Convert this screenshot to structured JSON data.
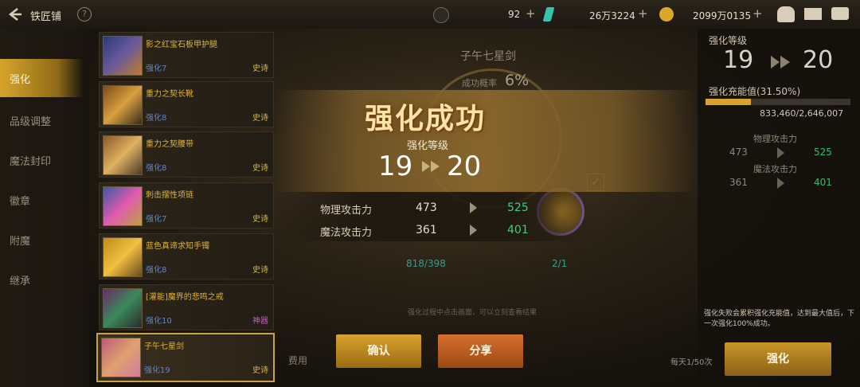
{
  "header": {
    "title": "铁匠铺",
    "res1": "92",
    "res2": "26万3224",
    "res3": "2099万0135"
  },
  "nav": {
    "items": [
      "强化",
      "品级调整",
      "魔法封印",
      "徽章",
      "附魔",
      "继承"
    ]
  },
  "equipment": [
    {
      "name": "影之红宝石板甲护腿",
      "level": "强化7",
      "rarity": "史诗"
    },
    {
      "name": "重力之契长靴",
      "level": "强化8",
      "rarity": "史诗"
    },
    {
      "name": "重力之契腰带",
      "level": "强化8",
      "rarity": "史诗"
    },
    {
      "name": "刺击摆性项链",
      "level": "强化7",
      "rarity": "史诗"
    },
    {
      "name": "蓝色真谛求知手镯",
      "level": "强化8",
      "rarity": "史诗"
    },
    {
      "name": "[灌能]魔界的悲鸣之戒",
      "level": "强化10",
      "rarity": "神器"
    },
    {
      "name": "子午七星剑",
      "level": "强化19",
      "rarity": "史诗"
    }
  ],
  "center": {
    "weapon_name": "子午七星剑",
    "success_label": "成功概率",
    "success_rate": "6%",
    "stat_left_value": "818/398",
    "stat_right_value": "2/1",
    "hint": "强化过程中点击画面，可以立刻查看结果",
    "cost_label": "费用"
  },
  "popup": {
    "title": "强化成功",
    "subtitle": "强化等级",
    "from": "19",
    "to": "20",
    "stats": [
      {
        "label": "物理攻击力",
        "from": "473",
        "to": "525"
      },
      {
        "label": "魔法攻击力",
        "from": "361",
        "to": "401"
      }
    ],
    "confirm": "确认",
    "share": "分享"
  },
  "right": {
    "level_label": "强化等级",
    "from": "19",
    "to": "20",
    "charge_label": "强化充能值(31.50%)",
    "charge_value": "833,460/2,646,007",
    "charge_fraction": 0.315,
    "stats": [
      {
        "label": "物理攻击力",
        "from": "473",
        "to": "525"
      },
      {
        "label": "魔法攻击力",
        "from": "361",
        "to": "401"
      }
    ],
    "note": "强化失败会累积强化充能值，达到最大值后，下一次强化100%成功。",
    "daily": "每天1/50次",
    "enhance": "强化"
  }
}
